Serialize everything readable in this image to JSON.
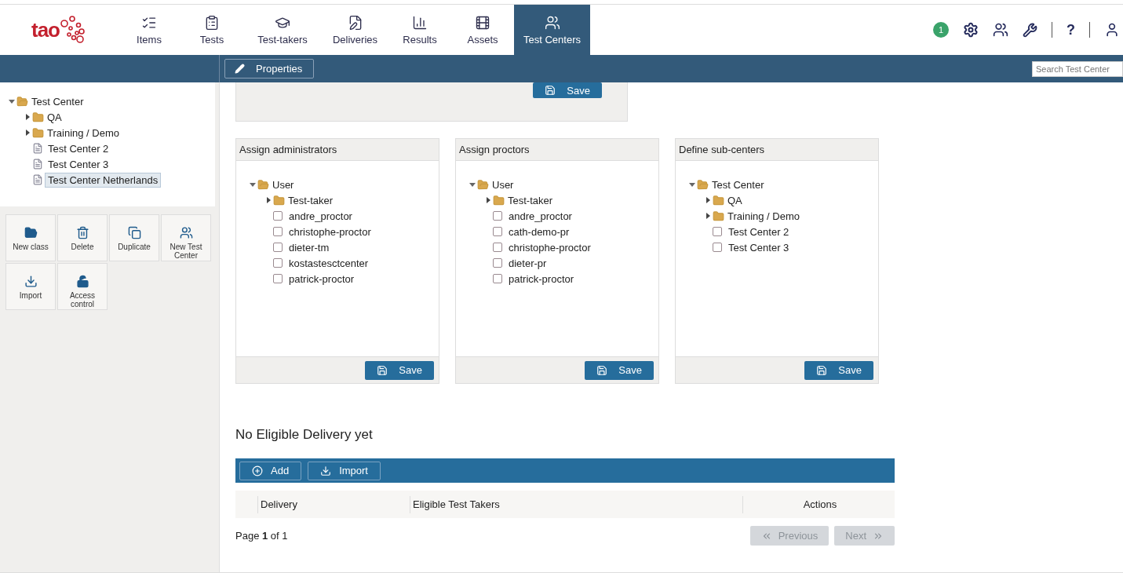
{
  "header": {
    "logo": "tao",
    "tabs": [
      {
        "label": "Items",
        "selected": false
      },
      {
        "label": "Tests",
        "selected": false
      },
      {
        "label": "Test-takers",
        "selected": false
      },
      {
        "label": "Deliveries",
        "selected": false
      },
      {
        "label": "Results",
        "selected": false
      },
      {
        "label": "Assets",
        "selected": false
      },
      {
        "label": "Test Centers",
        "selected": true
      }
    ],
    "notification_count": "1",
    "help": "?"
  },
  "action_bar": {
    "properties_button": "Properties",
    "search": {
      "placeholder": "Search Test Center"
    }
  },
  "sidebar": {
    "tree": [
      {
        "label": "Test Center",
        "kind": "folder",
        "expanded": true,
        "selected": false,
        "children": [
          {
            "label": "QA",
            "kind": "folder",
            "expanded": false,
            "selected": false
          },
          {
            "label": "Training / Demo",
            "kind": "folder",
            "expanded": false,
            "selected": false
          },
          {
            "label": "Test Center 2",
            "kind": "item",
            "selected": false
          },
          {
            "label": "Test Center 3",
            "kind": "item",
            "selected": false
          },
          {
            "label": "Test Center Netherlands",
            "kind": "item",
            "selected": true
          }
        ]
      }
    ],
    "actions": [
      {
        "label": "New class"
      },
      {
        "label": "Delete"
      },
      {
        "label": "Duplicate"
      },
      {
        "label": "New Test Center"
      },
      {
        "label": "Import"
      },
      {
        "label": "Access control"
      }
    ]
  },
  "top_panel": {
    "save": "Save"
  },
  "panels": [
    {
      "title": "Assign administrators",
      "save": "Save",
      "tree": [
        {
          "label": "User",
          "kind": "folder",
          "expanded": true,
          "children": [
            {
              "label": "Test-taker",
              "kind": "folder",
              "expanded": false
            },
            {
              "label": "andre_proctor",
              "kind": "item",
              "checked": false
            },
            {
              "label": "christophe-proctor",
              "kind": "item",
              "checked": false
            },
            {
              "label": "dieter-tm",
              "kind": "item",
              "checked": false
            },
            {
              "label": "kostastesctcenter",
              "kind": "item",
              "checked": false
            },
            {
              "label": "patrick-proctor",
              "kind": "item",
              "checked": false
            }
          ]
        }
      ]
    },
    {
      "title": "Assign proctors",
      "save": "Save",
      "tree": [
        {
          "label": "User",
          "kind": "folder",
          "expanded": true,
          "children": [
            {
              "label": "Test-taker",
              "kind": "folder",
              "expanded": false
            },
            {
              "label": "andre_proctor",
              "kind": "item",
              "checked": false
            },
            {
              "label": "cath-demo-pr",
              "kind": "item",
              "checked": false
            },
            {
              "label": "christophe-proctor",
              "kind": "item",
              "checked": false
            },
            {
              "label": "dieter-pr",
              "kind": "item",
              "checked": false
            },
            {
              "label": "patrick-proctor",
              "kind": "item",
              "checked": false
            }
          ]
        }
      ]
    },
    {
      "title": "Define sub-centers",
      "save": "Save",
      "tree": [
        {
          "label": "Test Center",
          "kind": "folder",
          "expanded": true,
          "children": [
            {
              "label": "QA",
              "kind": "folder",
              "expanded": false
            },
            {
              "label": "Training / Demo",
              "kind": "folder",
              "expanded": false
            },
            {
              "label": "Test Center 2",
              "kind": "item",
              "checked": false
            },
            {
              "label": "Test Center 3",
              "kind": "item",
              "checked": false
            }
          ]
        }
      ]
    }
  ],
  "deliveries": {
    "title": "No Eligible Delivery yet",
    "buttons": [
      {
        "label": "Add"
      },
      {
        "label": "Import"
      }
    ],
    "columns": [
      "Delivery",
      "Eligible Test Takers",
      "Actions"
    ],
    "pager": {
      "text": "Page **1** of 1",
      "previous": {
        "label": "Previous",
        "disabled": true
      },
      "next": {
        "label": "Next",
        "disabled": true
      }
    }
  }
}
